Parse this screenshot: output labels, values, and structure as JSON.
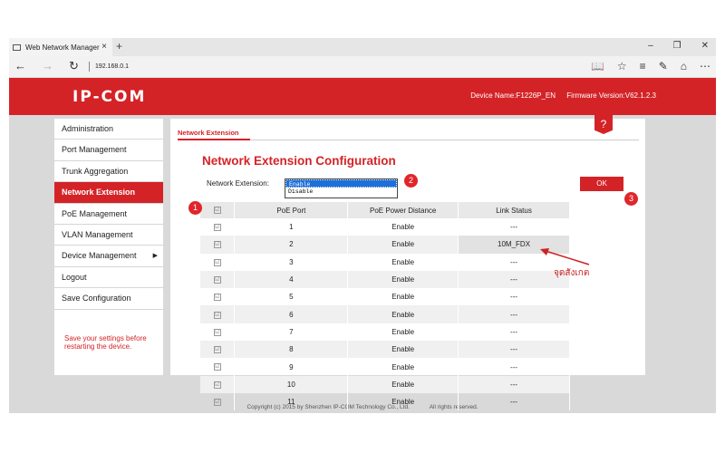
{
  "browser": {
    "tab_title": "Web Network Manager",
    "tab_close": "×",
    "new_tab": "+",
    "address": "192.168.0.1",
    "window_buttons": [
      "–",
      "❐",
      "✕"
    ],
    "nav": [
      "←",
      "→",
      "↻"
    ],
    "tools": [
      "📖",
      "☆",
      "≡",
      "✎",
      "⌂",
      "⋯"
    ]
  },
  "router": {
    "logo": "IP-COM",
    "device_name": "Device Name:F1226P_EN",
    "firmware": "Firmware Version:V62.1.2.3"
  },
  "sidebar": {
    "items": [
      {
        "label": "Administration",
        "active": false
      },
      {
        "label": "Port Management",
        "active": false
      },
      {
        "label": "Trunk Aggregation",
        "active": false
      },
      {
        "label": "Network Extension",
        "active": true
      },
      {
        "label": "PoE Management",
        "active": false
      },
      {
        "label": "VLAN Management",
        "active": false
      },
      {
        "label": "Device Management",
        "active": false,
        "arrow": "▶"
      },
      {
        "label": "Logout",
        "active": false
      },
      {
        "label": "Save Configuration",
        "active": false
      }
    ],
    "note": "Save your settings before restarting the device."
  },
  "content": {
    "tab": "Network Extension",
    "help": "?",
    "title": "Network Extension Configuration",
    "ext_label": "Network Extension:",
    "ext_options": [
      "Enable",
      "Disable"
    ],
    "ext_selected": "Enable",
    "ok": "OK",
    "table": {
      "headers": [
        "",
        "PoE Port",
        "PoE Power Distance",
        "Link Status"
      ],
      "check": "☑",
      "rows": [
        {
          "port": "1",
          "distance": "Enable",
          "status": "---"
        },
        {
          "port": "2",
          "distance": "Enable",
          "status": "10M_FDX"
        },
        {
          "port": "3",
          "distance": "Enable",
          "status": "---"
        },
        {
          "port": "4",
          "distance": "Enable",
          "status": "---"
        },
        {
          "port": "5",
          "distance": "Enable",
          "status": "---"
        },
        {
          "port": "6",
          "distance": "Enable",
          "status": "---"
        },
        {
          "port": "7",
          "distance": "Enable",
          "status": "---"
        },
        {
          "port": "8",
          "distance": "Enable",
          "status": "---"
        },
        {
          "port": "9",
          "distance": "Enable",
          "status": "---"
        },
        {
          "port": "10",
          "distance": "Enable",
          "status": "---"
        },
        {
          "port": "11",
          "distance": "Enable",
          "status": "---"
        }
      ]
    }
  },
  "footer": {
    "copyright": "Copyright (c) 2015 by Shenzhen IP-COM Technology Co., Ltd.",
    "rights": "All rights reserved."
  },
  "annotations": {
    "markers": [
      "1",
      "2",
      "3"
    ],
    "note": "จุดสังเกต",
    "color": "#e0262b"
  }
}
